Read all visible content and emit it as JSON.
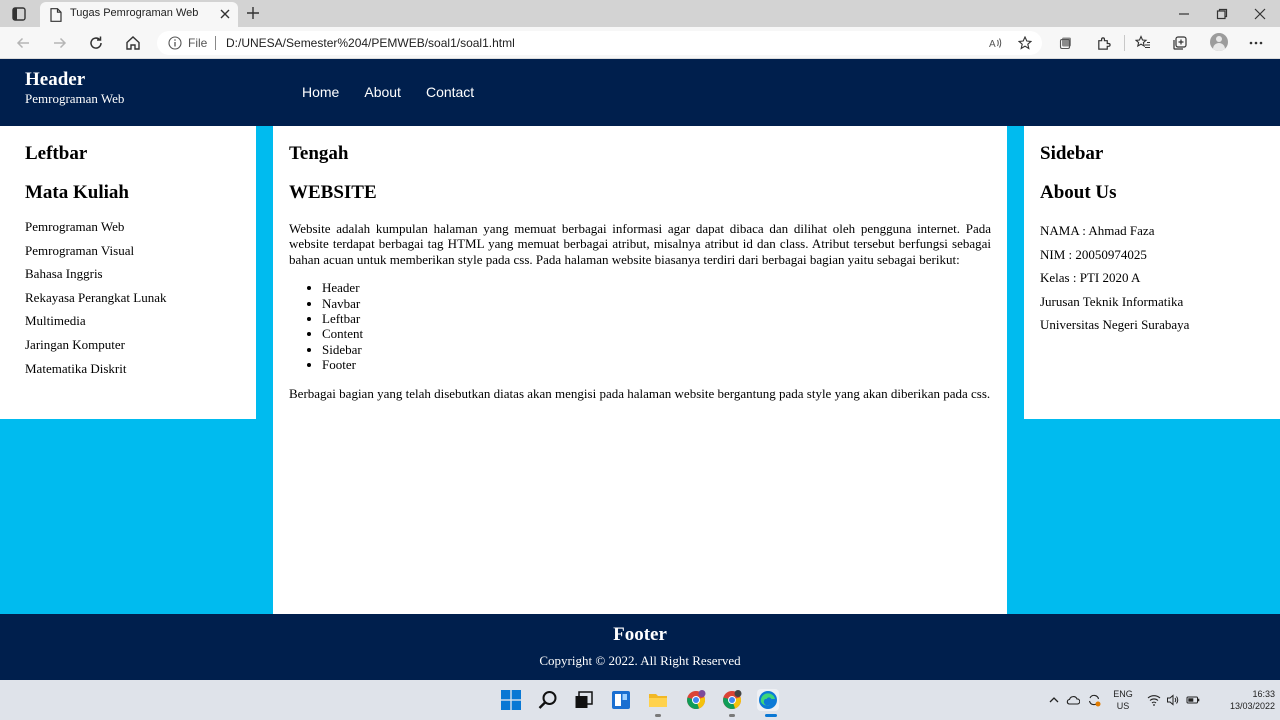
{
  "browser": {
    "tab_title": "Tugas Pemrograman Web",
    "file_label": "File",
    "url": "D:/UNESA/Semester%204/PEMWEB/soal1/soal1.html"
  },
  "site": {
    "header_title": "Header",
    "header_subtitle": "Pemrograman Web",
    "nav": [
      "Home",
      "About",
      "Contact"
    ],
    "leftbar": {
      "title": "Leftbar",
      "subtitle": "Mata Kuliah",
      "items": [
        "Pemrograman Web",
        "Pemrograman Visual",
        "Bahasa Inggris",
        "Rekayasa Perangkat Lunak",
        "Multimedia",
        "Jaringan Komputer",
        "Matematika Diskrit"
      ]
    },
    "center": {
      "title": "Tengah",
      "subtitle": "WEBSITE",
      "paragraph1": "Website adalah kumpulan halaman yang memuat berbagai informasi agar dapat dibaca dan dilihat oleh pengguna internet. Pada website terdapat berbagai tag HTML yang memuat berbagai atribut, misalnya atribut id dan class. Atribut tersebut berfungsi sebagai bahan acuan untuk memberikan style pada css. Pada halaman website biasanya terdiri dari berbagai bagian yaitu sebagai berikut:",
      "bullets": [
        "Header",
        "Navbar",
        "Leftbar",
        "Content",
        "Sidebar",
        "Footer"
      ],
      "paragraph2": "Berbagai bagian yang telah disebutkan diatas akan mengisi pada halaman website bergantung pada style yang akan diberikan pada css."
    },
    "sidebar": {
      "title": "Sidebar",
      "subtitle": "About Us",
      "items": [
        "NAMA : Ahmad Faza",
        "NIM : 20050974025",
        "Kelas : PTI 2020 A",
        "Jurusan Teknik Informatika",
        "Universitas Negeri Surabaya"
      ]
    },
    "footer_title": "Footer",
    "footer_copy": "Copyright © 2022. All Right Reserved"
  },
  "taskbar": {
    "lang_line1": "ENG",
    "lang_line2": "US",
    "time": "16:33",
    "date": "13/03/2022"
  },
  "colors": {
    "site_dark": "#001f4d",
    "site_accent": "#00bbef",
    "chrome_bg": "#d3d3d3"
  }
}
